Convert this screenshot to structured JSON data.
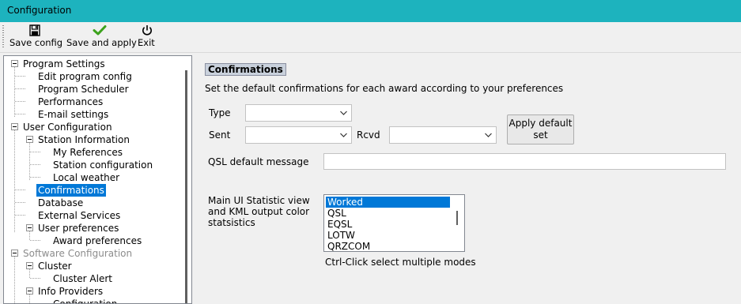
{
  "window": {
    "title": "Configuration"
  },
  "toolbar": {
    "save_label": "Save config",
    "apply_label": "Save and apply",
    "exit_label": "Exit"
  },
  "tree": {
    "program_settings": "Program Settings",
    "edit_program_config": "Edit program config",
    "program_scheduler": "Program Scheduler",
    "performances": "Performances",
    "email_settings": "E-mail settings",
    "user_configuration": "User Configuration",
    "station_information": "Station Information",
    "my_references": "My References",
    "station_configuration": "Station configuration",
    "local_weather": "Local weather",
    "confirmations": "Confirmations",
    "database": "Database",
    "external_services": "External Services",
    "user_preferences": "User preferences",
    "award_preferences": "Award preferences",
    "software_configuration": "Software Configuration",
    "cluster": "Cluster",
    "cluster_alert": "Cluster Alert",
    "info_providers": "Info Providers",
    "configuration": "Configuration"
  },
  "panel": {
    "heading": "Confirmations",
    "description": "Set the default confirmations for each award according to your preferences",
    "type_label": "Type",
    "type_value": "",
    "sent_label": "Sent",
    "sent_value": "",
    "rcvd_label": "Rcvd",
    "rcvd_value": "",
    "apply_default_line1": "Apply default",
    "apply_default_line2": "set",
    "qsl_label": "QSL default message",
    "qsl_value": "",
    "stat_label_line1": "Main UI Statistic view",
    "stat_label_line2": "and KML output color",
    "stat_label_line3": "statsistics",
    "modes": [
      "Worked",
      "QSL",
      "EQSL",
      "LOTW",
      "QRZCOM"
    ],
    "hint": "Ctrl-Click select multiple modes"
  },
  "colors": {
    "titlebar": "#1db3be",
    "selection": "#0078d7"
  }
}
